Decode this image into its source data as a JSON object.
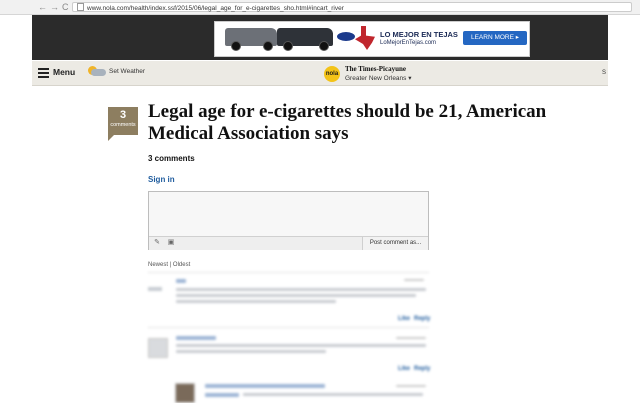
{
  "browser": {
    "url": "www.nola.com/health/index.ssf/2015/06/legal_age_for_e-cigarettes_sho.html#incart_river",
    "back_glyph": "←",
    "forward_glyph": "→",
    "reload_glyph": "C"
  },
  "ad": {
    "headline": "LO MEJOR EN TEJAS",
    "subline": "LoMejorEnTejas.com",
    "cta": "LEARN MORE ▸"
  },
  "nav": {
    "menu_label": "Menu",
    "weather_label": "Set Weather",
    "logo_text": "nola",
    "brand": "The Times-Picayune",
    "region": "Greater New Orleans ▾",
    "edge_letter": "S"
  },
  "article": {
    "headline": "Legal age for e-cigarettes should be 21, American Medical Association says",
    "badge_count": "3",
    "badge_label": "comments"
  },
  "comments": {
    "count_label": "3 comments",
    "sign_in": "Sign in",
    "post_button": "Post comment as...",
    "sort_newest": "Newest",
    "sort_separator": " | ",
    "sort_oldest": "Oldest",
    "like_label": "Like",
    "reply_label": "Reply"
  },
  "icons": {
    "pencil": "✎",
    "image": "▣"
  }
}
